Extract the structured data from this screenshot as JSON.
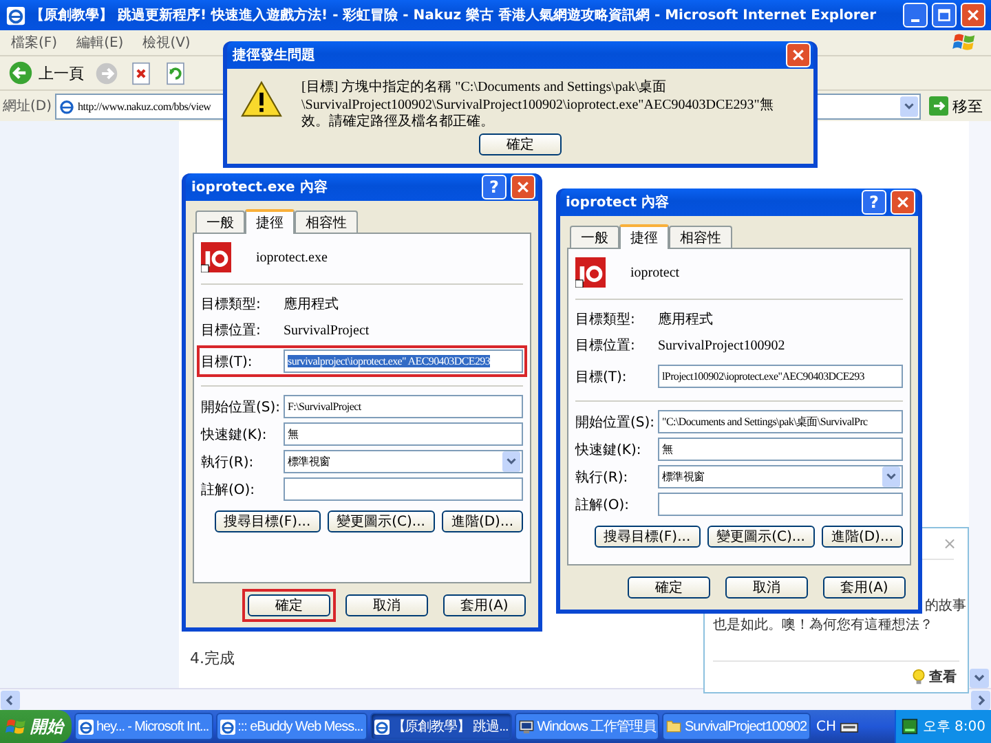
{
  "browser": {
    "title": "【原創教學】 跳過更新程序! 快速進入遊戲方法! - 彩虹冒險 - Nakuz 樂古 香港人氣網遊攻略資訊網 - Microsoft Internet Explorer",
    "menu": [
      "檔案(F)",
      "編輯(E)",
      "檢視(V)"
    ],
    "back_label": "上一頁",
    "address_label": "網址(D)",
    "address_value": "http://www.nakuz.com/bbs/view",
    "go_label": "移至"
  },
  "page": {
    "step_text": "4.完成",
    "popup": {
      "close": "×",
      "line_1": "的故事",
      "line_2": "也是如此。噢！為何您有這種想法？",
      "link": "查看"
    }
  },
  "error_dialog": {
    "title": "捷徑發生問題",
    "message": "[目標] 方塊中指定的名稱 \"C:\\Documents and Settings\\pak\\桌面\\SurvivalProject100902\\SurvivalProject100902\\ioprotect.exe\"AEC90403DCE293\"無效。請確定路徑及檔名都正確。",
    "button": "確定"
  },
  "property_dialogs": [
    {
      "title": "ioprotect.exe 內容",
      "help": "?",
      "tabs": [
        {
          "label": "一般",
          "selected": false
        },
        {
          "label": "捷徑",
          "selected": true
        },
        {
          "label": "相容性",
          "selected": false
        }
      ],
      "file_name": "ioprotect.exe",
      "info_rows": [
        {
          "label": "目標類型:",
          "value": "應用程式"
        },
        {
          "label": "目標位置:",
          "value": "SurvivalProject"
        }
      ],
      "target": {
        "label": "目標(T):",
        "value": "survivalproject\\ioprotect.exe\" AEC90403DCE293",
        "selected": true,
        "annotated": true
      },
      "fields": [
        {
          "kind": "text",
          "label": "開始位置(S):",
          "value": "F:\\SurvivalProject"
        },
        {
          "kind": "text",
          "label": "快速鍵(K):",
          "value": "無"
        },
        {
          "kind": "dropdown",
          "label": "執行(R):",
          "value": "標準視窗"
        },
        {
          "kind": "text",
          "label": "註解(O):"
        }
      ],
      "action_buttons": [
        "搜尋目標(F)...",
        "變更圖示(C)...",
        "進階(D)..."
      ],
      "footer_buttons": [
        {
          "label": "確定",
          "annotated": true
        },
        {
          "label": "取消",
          "annotated": false
        },
        {
          "label": "套用(A)",
          "annotated": false
        }
      ]
    },
    {
      "title": "ioprotect 內容",
      "help": "?",
      "tabs": [
        {
          "label": "一般",
          "selected": false
        },
        {
          "label": "捷徑",
          "selected": true
        },
        {
          "label": "相容性",
          "selected": false
        }
      ],
      "file_name": "ioprotect",
      "info_rows": [
        {
          "label": "目標類型:",
          "value": "應用程式"
        },
        {
          "label": "目標位置:",
          "value": "SurvivalProject100902"
        }
      ],
      "target": {
        "label": "目標(T):",
        "value": "lProject100902\\ioprotect.exe\"AEC90403DCE293",
        "selected": false,
        "annotated": false
      },
      "fields": [
        {
          "kind": "text",
          "label": "開始位置(S):",
          "value": "\"C:\\Documents and Settings\\pak\\桌面\\SurvivalPrc"
        },
        {
          "kind": "text",
          "label": "快速鍵(K):",
          "value": "無"
        },
        {
          "kind": "dropdown",
          "label": "執行(R):",
          "value": "標準視窗"
        },
        {
          "kind": "text",
          "label": "註解(O):"
        }
      ],
      "action_buttons": [
        "搜尋目標(F)...",
        "變更圖示(C)...",
        "進階(D)..."
      ],
      "footer_buttons": [
        {
          "label": "確定",
          "annotated": false
        },
        {
          "label": "取消",
          "annotated": false
        },
        {
          "label": "套用(A)",
          "annotated": false
        }
      ]
    }
  ],
  "taskbar": {
    "start": "開始",
    "tasks": [
      {
        "label": "hey... - Microsoft Int...",
        "kind": "ie",
        "selected": false
      },
      {
        "label": "::: eBuddy Web Mess...",
        "kind": "ie",
        "selected": false
      },
      {
        "label": "【原創教學】 跳過...",
        "kind": "ie",
        "selected": true
      },
      {
        "label": "Windows 工作管理員",
        "kind": "monitor",
        "selected": false
      },
      {
        "label": "SurvivalProject100902",
        "kind": "folder",
        "selected": false
      }
    ],
    "language": "CH",
    "clock": "오후 8:00"
  }
}
